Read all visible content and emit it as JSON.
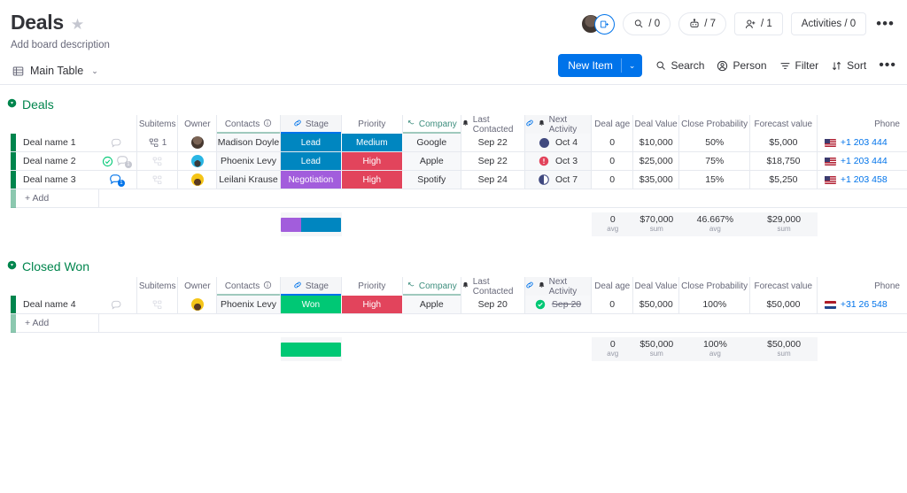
{
  "header": {
    "title": "Deals",
    "star_icon": "star-icon",
    "description": "Add board description",
    "view_tab": "Main Table",
    "view_icon": "table-icon",
    "chevron": "⌄",
    "automations": "/ 0",
    "integrations": "/ 7",
    "invite_count": "/ 1",
    "activities": "Activities / 0",
    "more": "•••"
  },
  "toolbar": {
    "new_item": "New Item",
    "new_item_chevron": "⌄",
    "search": "Search",
    "person": "Person",
    "filter": "Filter",
    "sort": "Sort",
    "more": "•••"
  },
  "columns": [
    {
      "label": "",
      "key": "name"
    },
    {
      "label": "",
      "key": "chat"
    },
    {
      "label": "Subitems",
      "key": "subitems"
    },
    {
      "label": "Owner",
      "key": "owner"
    },
    {
      "label": "Contacts",
      "key": "contacts",
      "info": "ⓘ",
      "underline": "teal"
    },
    {
      "label": "Stage",
      "key": "stage",
      "link": true,
      "shaded": true,
      "underline": "blue"
    },
    {
      "label": "Priority",
      "key": "priority"
    },
    {
      "label": "Company",
      "key": "company",
      "teal": true,
      "link_alt": true,
      "underline": "teal"
    },
    {
      "label": "Last Contacted",
      "key": "last_contacted",
      "bell": true
    },
    {
      "label": "Next Activity",
      "key": "next_activity",
      "link": true,
      "bell": true,
      "shaded": true
    },
    {
      "label": "Deal age",
      "key": "deal_age"
    },
    {
      "label": "Deal Value",
      "key": "deal_value"
    },
    {
      "label": "Close Probability",
      "key": "close_probability"
    },
    {
      "label": "Forecast value",
      "key": "forecast_value"
    },
    {
      "label": "Phone",
      "key": "phone"
    }
  ],
  "colors": {
    "group_green": "#00854d",
    "stage_lead": "#0086c0",
    "stage_negotiation": "#a25ddc",
    "stage_won": "#00c875",
    "priority_medium": "#0086c0",
    "priority_high": "#e2445c",
    "accent_blue": "#0073ea",
    "teal": "#3e8e7e"
  },
  "groups": [
    {
      "name": "Deals",
      "color": "#00854d",
      "collapse_icon": "collapse-icon",
      "add_label": "+ Add",
      "rows": [
        {
          "name": "Deal name 1",
          "chat_icons": [
            "chat-bubble-icon"
          ],
          "subitems": "1",
          "owner_avatar": "avatar-madison",
          "contacts": "Madison Doyle",
          "stage": "Lead",
          "stage_color": "#0086c0",
          "priority": "Medium",
          "priority_color": "#0086c0",
          "company": "Google",
          "last_contacted": "Sep 22",
          "next_activity": "Oct 4",
          "next_activity_icon": "navy-circle-icon",
          "next_activity_icon_color": "#40497f",
          "deal_age": "0",
          "deal_value": "$10,000",
          "close_probability": "50%",
          "forecast_value": "$5,000",
          "phone": "+1 203 444",
          "flag": "us"
        },
        {
          "name": "Deal name 2",
          "chat_icons": [
            "check-circle-icon",
            "chat-bubble-badge-icon"
          ],
          "subitems": "",
          "owner_avatar": "avatar-phoenix",
          "contacts": "Phoenix Levy",
          "stage": "Lead",
          "stage_color": "#0086c0",
          "priority": "High",
          "priority_color": "#e2445c",
          "company": "Apple",
          "last_contacted": "Sep 22",
          "next_activity": "Oct 3",
          "next_activity_icon": "alert-circle-icon",
          "next_activity_icon_color": "#e2445c",
          "deal_age": "0",
          "deal_value": "$25,000",
          "close_probability": "75%",
          "forecast_value": "$18,750",
          "phone": "+1 203 444",
          "flag": "us"
        },
        {
          "name": "Deal name 3",
          "chat_icons": [
            "chat-bubble-badge-blue-icon"
          ],
          "subitems": "",
          "owner_avatar": "avatar-leilani",
          "contacts": "Leilani Krause",
          "stage": "Negotiation",
          "stage_color": "#a25ddc",
          "priority": "High",
          "priority_color": "#e2445c",
          "company": "Spotify",
          "last_contacted": "Sep 24",
          "next_activity": "Oct 7",
          "next_activity_icon": "half-circle-icon",
          "next_activity_icon_color": "#40497f",
          "deal_age": "0",
          "deal_value": "$35,000",
          "close_probability": "15%",
          "forecast_value": "$5,250",
          "phone": "+1 203 458",
          "flag": "us"
        }
      ],
      "summary": {
        "stage_bar": [
          {
            "color": "#a25ddc",
            "pct": 33.3
          },
          {
            "color": "#0086c0",
            "pct": 66.7
          }
        ],
        "deal_age": "0",
        "deal_age_sub": "avg",
        "deal_value": "$70,000",
        "deal_value_sub": "sum",
        "close_probability": "46.667%",
        "close_probability_sub": "avg",
        "forecast_value": "$29,000",
        "forecast_value_sub": "sum"
      }
    },
    {
      "name": "Closed Won",
      "color": "#00854d",
      "collapse_icon": "collapse-icon",
      "add_label": "+ Add",
      "rows": [
        {
          "name": "Deal name 4",
          "chat_icons": [
            "chat-bubble-icon"
          ],
          "subitems": "",
          "owner_avatar": "avatar-leilani",
          "contacts": "Phoenix Levy",
          "stage": "Won",
          "stage_color": "#00c875",
          "priority": "High",
          "priority_color": "#e2445c",
          "company": "Apple",
          "last_contacted": "Sep 20",
          "next_activity": "Sep 20",
          "next_activity_done": true,
          "next_activity_icon": "check-circle-green-icon",
          "next_activity_icon_color": "#00c875",
          "deal_age": "0",
          "deal_value": "$50,000",
          "close_probability": "100%",
          "forecast_value": "$50,000",
          "phone": "+31 26 548",
          "flag": "nl"
        }
      ],
      "summary": {
        "stage_bar": [
          {
            "color": "#00c875",
            "pct": 100
          }
        ],
        "deal_age": "0",
        "deal_age_sub": "avg",
        "deal_value": "$50,000",
        "deal_value_sub": "sum",
        "close_probability": "100%",
        "close_probability_sub": "avg",
        "forecast_value": "$50,000",
        "forecast_value_sub": "sum"
      }
    }
  ]
}
